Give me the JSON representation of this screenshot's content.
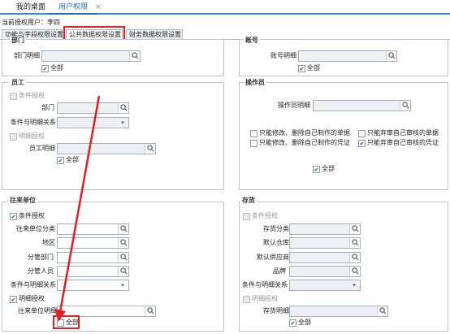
{
  "tabs": [
    {
      "label": "我的桌面"
    },
    {
      "label": "用户权限"
    }
  ],
  "current_user": {
    "label": "当前授权用户：",
    "value": "李四"
  },
  "subtabs": [
    {
      "label": "功能与字段权限设置"
    },
    {
      "label": "公共数据权限设置"
    },
    {
      "label": "财务数据权限设置"
    }
  ],
  "dept": {
    "title": "部门",
    "detail_label": "部门明细",
    "all_label": "全部"
  },
  "account": {
    "title": "账号",
    "detail_label": "账号明细",
    "all_label": "全部"
  },
  "employee": {
    "title": "员工",
    "cond_label": "条件授权",
    "dept_label": "部门",
    "relation_label": "条件与明细关系",
    "detail_auth_label": "明细授权",
    "detail_label": "员工明细",
    "all_label": "全部"
  },
  "operator": {
    "title": "操作员",
    "detail_label": "操作员明细",
    "opt1": "只能修改、删除自己制作的单据",
    "opt2": "只能弃审自己审核的单据",
    "opt3": "只能修改、删除自己制作的凭证",
    "opt4": "只能弃审自己审核的凭证",
    "all_label": "全部"
  },
  "partner": {
    "title": "往来单位",
    "cond_label": "条件授权",
    "category_label": "往来单位分类",
    "region_label": "地区",
    "mgr_dept_label": "分管部门",
    "mgr_person_label": "分管人员",
    "relation_label": "条件与明细关系",
    "detail_auth_label": "明细授权",
    "detail_label": "往来单位明细",
    "all_label": "全部"
  },
  "inventory": {
    "title": "存货",
    "cond_label": "条件授权",
    "category_label": "存货分类",
    "warehouse_label": "默认仓库",
    "supplier_label": "默认供应商",
    "brand_label": "品牌",
    "relation_label": "条件与明细关系",
    "detail_auth_label": "明细授权",
    "detail_label": "存货明细",
    "all_label": "全部"
  },
  "colors": {
    "accent": "#3b86d8",
    "highlight": "#e02020",
    "tab_active": "#1f6fc7"
  }
}
